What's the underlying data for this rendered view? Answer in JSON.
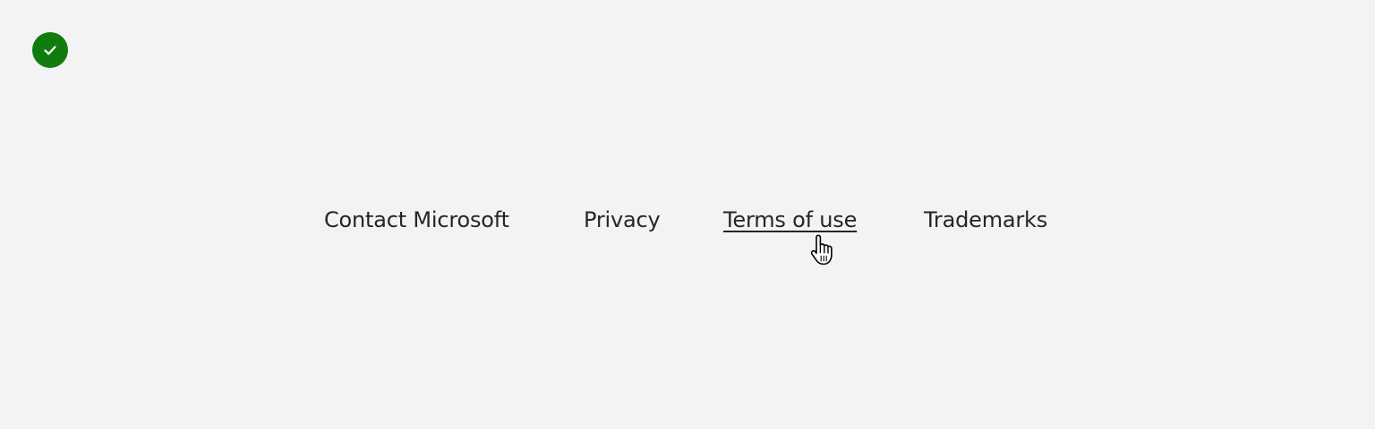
{
  "status": {
    "icon": "checkmark-circle-icon",
    "color": "#107c10"
  },
  "footer": {
    "links": [
      {
        "label": "Contact Microsoft"
      },
      {
        "label": "Privacy"
      },
      {
        "label": "Terms of use",
        "state": "hover"
      },
      {
        "label": "Trademarks"
      }
    ]
  },
  "cursor": {
    "icon": "hand-pointer-cursor-icon"
  }
}
